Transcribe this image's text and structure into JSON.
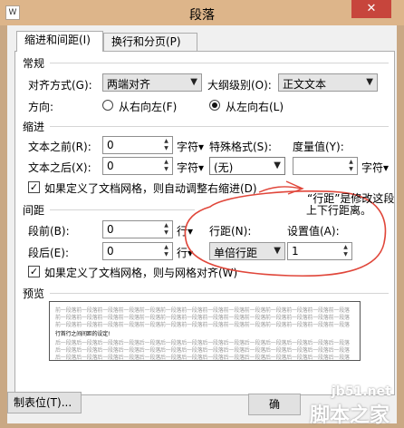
{
  "window": {
    "title": "段落",
    "close": "✕"
  },
  "tabs": [
    {
      "label": "缩进和间距(I)"
    },
    {
      "label": "换行和分页(P)"
    }
  ],
  "general": {
    "section": "常规",
    "align_label": "对齐方式(G):",
    "align_value": "两端对齐",
    "outline_label": "大纲级别(O):",
    "outline_value": "正文文本",
    "direction_label": "方向:",
    "rtl_label": "从右向左(F)",
    "ltr_label": "从左向右(L)"
  },
  "indent": {
    "section": "缩进",
    "before_label": "文本之前(R):",
    "before_value": "0",
    "before_unit": "字符▾",
    "after_label": "文本之后(X):",
    "after_value": "0",
    "after_unit": "字符▾",
    "special_label": "特殊格式(S):",
    "special_value": "(无)",
    "measure_label": "度量值(Y):",
    "measure_value": "",
    "measure_unit": "字符▾",
    "grid_check": "如果定义了文档网格，则自动调整右缩进(D)"
  },
  "spacing": {
    "section": "间距",
    "before_label": "段前(B):",
    "before_value": "0",
    "before_unit": "行▾",
    "after_label": "段后(E):",
    "after_value": "0",
    "after_unit": "行▾",
    "line_label": "行距(N):",
    "line_value": "单倍行距",
    "setting_label": "设置值(A):",
    "setting_value": "1",
    "grid_check": "如果定义了文档网格，则与网格对齐(W)"
  },
  "preview": {
    "section": "预览",
    "prev_text": "前一段落前一段落前一段落前一段落前一段落前一段落前一段落前一段落前一段落前一段落前一段落前一段落前一段落前一段落",
    "sample_text": "行首行之间间距的设定!",
    "next_text": "后一段落后一段落后一段落后一段落后一段落后一段落后一段落后一段落后一段落后一段落后一段落后一段落后一段落后一段落"
  },
  "buttons": {
    "tabs": "制表位(T)...",
    "ok": "确"
  },
  "annotation": {
    "line1": "“行距”是修改这段",
    "line2": "上下行距离。"
  },
  "watermark": {
    "site": "jb51.net",
    "brand": "脚本之家"
  },
  "colors": {
    "annotation_ink": "#e0463a",
    "titlebar": "#ddb58a",
    "close": "#c7453c"
  }
}
